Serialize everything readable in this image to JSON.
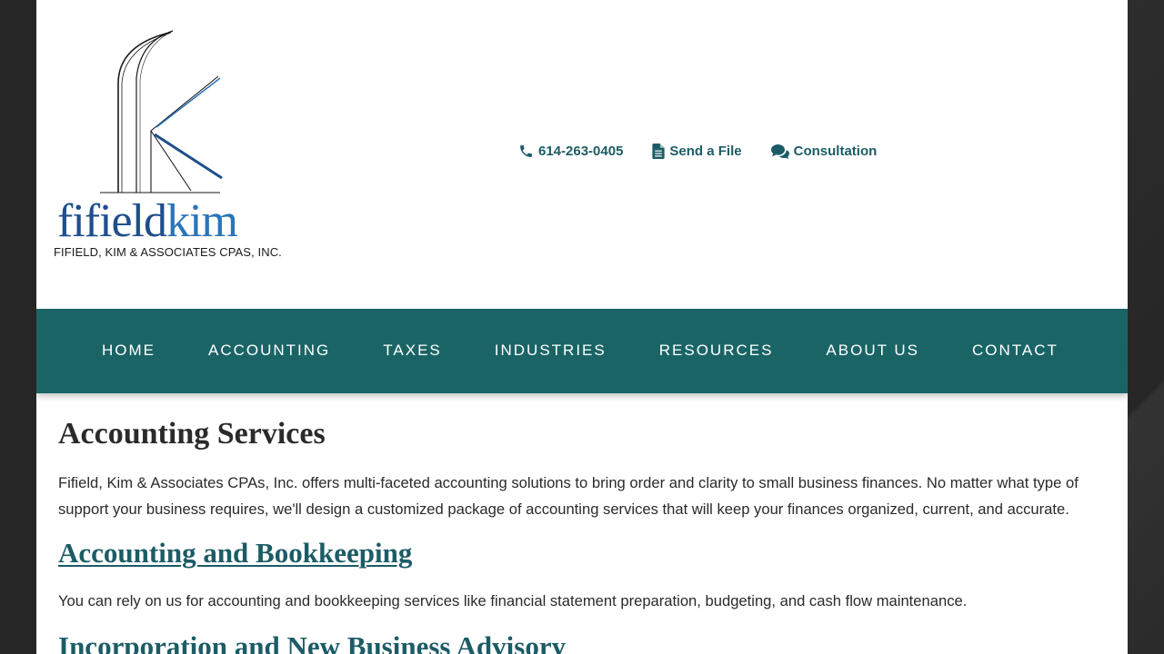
{
  "header": {
    "logo": {
      "wordmark_part1": "fifield",
      "wordmark_part2": "kim",
      "tagline": "FIFIELD, KIM & ASSOCIATES CPAS, INC."
    },
    "contact": {
      "phone": {
        "label": "614-263-0405",
        "icon": "phone-icon"
      },
      "send_file": {
        "label": "Send a File",
        "icon": "file-icon"
      },
      "consultation": {
        "label": "Consultation",
        "icon": "chat-icon"
      }
    }
  },
  "nav": {
    "items": [
      {
        "label": "HOME"
      },
      {
        "label": "ACCOUNTING"
      },
      {
        "label": "TAXES"
      },
      {
        "label": "INDUSTRIES"
      },
      {
        "label": "RESOURCES"
      },
      {
        "label": "ABOUT US"
      },
      {
        "label": "CONTACT"
      }
    ]
  },
  "main": {
    "title": "Accounting Services",
    "intro": "Fifield, Kim & Associates CPAs, Inc. offers multi-faceted accounting solutions to bring order and clarity to small business finances. No matter what type of support your business requires, we'll design a customized package of accounting services that will keep your finances organized, current, and accurate.",
    "sections": [
      {
        "heading": "Accounting and Bookkeeping",
        "body": "You can rely on us for accounting and bookkeeping services like financial statement preparation, budgeting, and cash flow maintenance."
      },
      {
        "heading": "Incorporation and New Business Advisory"
      }
    ]
  },
  "colors": {
    "nav_bg": "#1a6466",
    "accent": "#1c5c66",
    "logo_blue": "#1f4e8c",
    "text": "#2a2a2a"
  }
}
